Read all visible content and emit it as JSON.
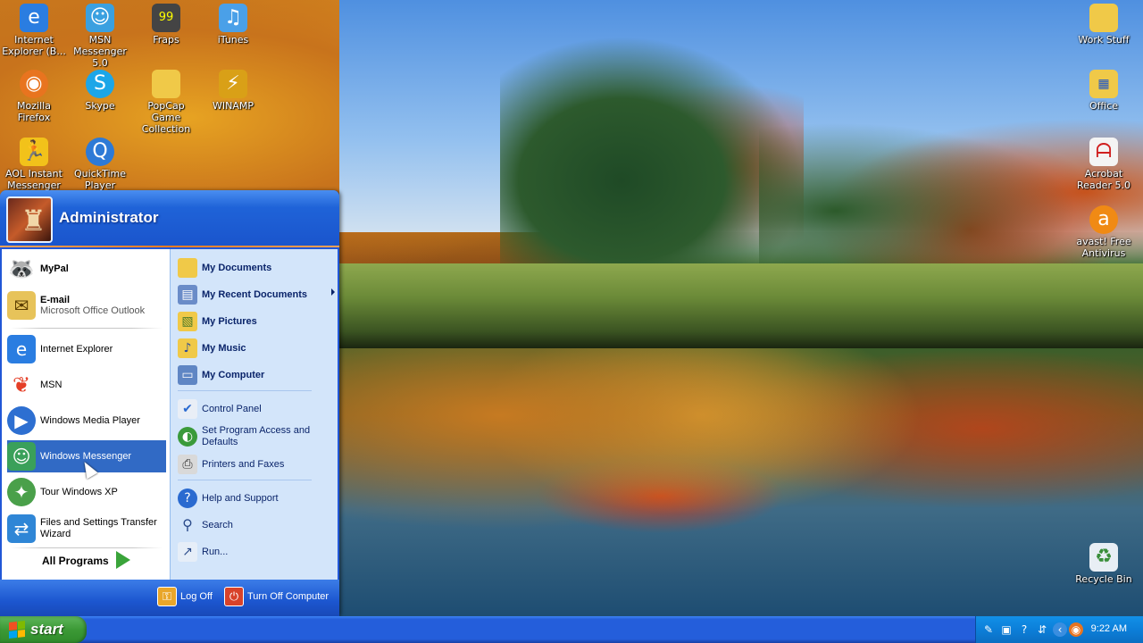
{
  "desktop": {
    "icons_left": [
      {
        "name": "internet-explorer-desktop-icon",
        "label": "Internet Explorer (B...",
        "icon": "ie-icon",
        "color": "#2a7de1"
      },
      {
        "name": "msn-messenger-desktop-icon",
        "label": "MSN Messenger 5.0",
        "icon": "messenger-icon",
        "color": "#3aa0e0"
      },
      {
        "name": "fraps-desktop-icon",
        "label": "Fraps",
        "icon": "fraps-icon",
        "color": "#444444"
      },
      {
        "name": "itunes-desktop-icon",
        "label": "iTunes",
        "icon": "itunes-icon",
        "color": "#4aa0e8"
      },
      {
        "name": "firefox-desktop-icon",
        "label": "Mozilla Firefox",
        "icon": "firefox-icon",
        "color": "#e8741f"
      },
      {
        "name": "skype-desktop-icon",
        "label": "Skype",
        "icon": "skype-icon",
        "color": "#1ca6e8"
      },
      {
        "name": "popcap-desktop-icon",
        "label": "PopCap Game Collection",
        "icon": "folder-icon",
        "color": "#f0c948"
      },
      {
        "name": "winamp-desktop-icon",
        "label": "WINAMP",
        "icon": "winamp-icon",
        "color": "#d9a017"
      },
      {
        "name": "aol-desktop-icon",
        "label": "AOL Instant Messenger",
        "icon": "aim-icon",
        "color": "#f2c21a"
      },
      {
        "name": "quicktime-desktop-icon",
        "label": "QuickTime Player",
        "icon": "quicktime-icon",
        "color": "#2d7ad6"
      }
    ],
    "icons_right": [
      {
        "name": "work-stuff-desktop-icon",
        "label": "Work Stuff",
        "icon": "folder-icon",
        "color": "#f0c948"
      },
      {
        "name": "office-desktop-icon",
        "label": "Office",
        "icon": "office-folder-icon",
        "color": "#f0c948"
      },
      {
        "name": "acrobat-desktop-icon",
        "label": "Acrobat Reader 5.0",
        "icon": "acrobat-icon",
        "color": "#d02020"
      },
      {
        "name": "avast-desktop-icon",
        "label": "avast! Free Antivirus",
        "icon": "avast-icon",
        "color": "#f08a14"
      },
      {
        "name": "recycle-bin-desktop-icon",
        "label": "Recycle Bin",
        "icon": "recycle-bin-icon",
        "color": "#3a8e3a"
      }
    ]
  },
  "start_menu": {
    "user_name": "Administrator",
    "left_items": [
      {
        "name": "mypal",
        "title": "MyPal",
        "subtitle": "",
        "bold": true,
        "icon": "raccoon-icon"
      },
      {
        "name": "email",
        "title": "E-mail",
        "subtitle": "Microsoft Office Outlook",
        "bold": true,
        "icon": "outlook-icon"
      },
      {
        "name": "internet-explorer",
        "title": "Internet Explorer",
        "subtitle": "",
        "bold": false,
        "icon": "ie-icon"
      },
      {
        "name": "msn",
        "title": "MSN",
        "subtitle": "",
        "bold": false,
        "icon": "msn-butterfly-icon"
      },
      {
        "name": "windows-media-player",
        "title": "Windows Media Player",
        "subtitle": "",
        "bold": false,
        "icon": "media-player-icon"
      },
      {
        "name": "windows-messenger",
        "title": "Windows Messenger",
        "subtitle": "",
        "bold": false,
        "icon": "messenger-icon"
      },
      {
        "name": "tour-windows-xp",
        "title": "Tour Windows XP",
        "subtitle": "",
        "bold": false,
        "icon": "tour-icon"
      },
      {
        "name": "files-settings-transfer",
        "title": "Files and Settings Transfer Wizard",
        "subtitle": "",
        "bold": false,
        "icon": "transfer-wizard-icon"
      }
    ],
    "all_programs": "All Programs",
    "right_items": [
      {
        "name": "my-documents",
        "title": "My Documents",
        "bold": true,
        "icon": "folder-icon"
      },
      {
        "name": "my-recent-documents",
        "title": "My Recent Documents",
        "bold": true,
        "icon": "recent-docs-icon"
      },
      {
        "name": "my-pictures",
        "title": "My Pictures",
        "bold": true,
        "icon": "folder-pictures-icon"
      },
      {
        "name": "my-music",
        "title": "My Music",
        "bold": true,
        "icon": "folder-music-icon"
      },
      {
        "name": "my-computer",
        "title": "My Computer",
        "bold": true,
        "icon": "computer-icon"
      },
      {
        "name": "control-panel",
        "title": "Control Panel",
        "bold": false,
        "icon": "control-panel-icon"
      },
      {
        "name": "set-program-access",
        "title": "Set Program Access and Defaults",
        "bold": false,
        "icon": "program-access-icon"
      },
      {
        "name": "printers-faxes",
        "title": "Printers and Faxes",
        "bold": false,
        "icon": "printer-icon"
      },
      {
        "name": "help-support",
        "title": "Help and Support",
        "bold": false,
        "icon": "help-icon"
      },
      {
        "name": "search",
        "title": "Search",
        "bold": false,
        "icon": "search-icon"
      },
      {
        "name": "run",
        "title": "Run...",
        "bold": false,
        "icon": "run-icon"
      }
    ],
    "footer": {
      "log_off": "Log Off",
      "turn_off": "Turn Off Computer"
    }
  },
  "taskbar": {
    "start_label": "start",
    "clock": "9:22 AM",
    "tray_icons": [
      "pen-tool-icon",
      "network-icon",
      "help-tray-icon",
      "usb-icon",
      "back-arrow-icon",
      "firefox-tray-icon"
    ]
  },
  "colors": {
    "taskbar_blue": "#245edb",
    "start_green": "#3c9a36",
    "tray_blue": "#0c7fd9",
    "selection_blue": "#316ac5",
    "right_pane": "#d3e5fa"
  }
}
